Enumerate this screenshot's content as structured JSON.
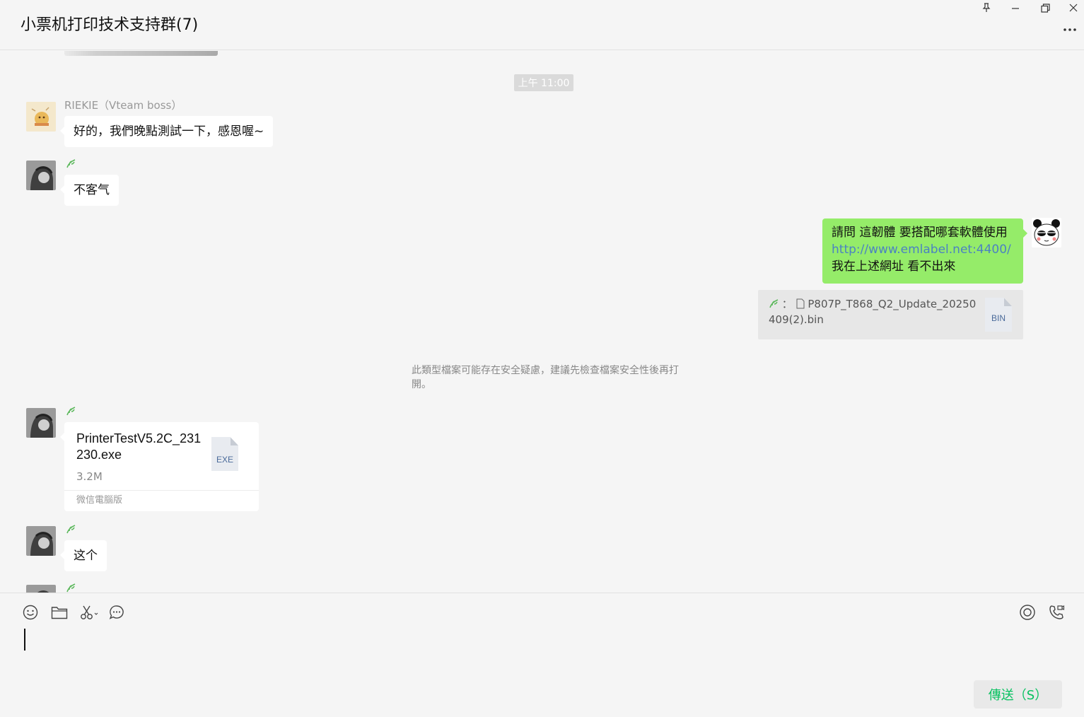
{
  "window": {
    "title": "小票机打印技术支持群(7)",
    "controls": [
      "pin-icon",
      "minimize-icon",
      "restore-icon",
      "close-icon"
    ],
    "more_label": "···"
  },
  "chat": {
    "timestamp": "上午 11:00",
    "messages": [
      {
        "sender": "RIEKIE（Vteam boss）",
        "text": "好的，我們晚點測試一下，感恩喔~"
      },
      {
        "sender_icon": "leaf-icon",
        "text": "不客气"
      },
      {
        "self": true,
        "lines": [
          "請問 這韌體 要搭配哪套軟體使用",
          "http://www.emlabel.net:4400/",
          "我在上述網址 看不出來"
        ],
        "quote": {
          "prefix": "：",
          "file_name_line1": "P807P_T868_Q2_Update_20250",
          "file_name_line2": "409(2).bin",
          "ext": "BIN"
        }
      },
      {
        "system": true,
        "text": "此類型檔案可能存在安全疑慮，建議先檢查檔案安全性後再打開。"
      },
      {
        "sender_icon": "leaf-icon",
        "file": {
          "name": "PrinterTestV5.2C_231230.exe",
          "size": "3.2M",
          "source": "微信電腦版",
          "ext": "EXE"
        }
      },
      {
        "sender_icon": "leaf-icon",
        "text": "这个"
      }
    ]
  },
  "input": {
    "tools": [
      "emoji-icon",
      "folder-icon",
      "scissors-icon",
      "chat-history-icon"
    ],
    "right_tools": [
      "live-icon",
      "call-icon"
    ],
    "send_label": "傳送（S）"
  },
  "colors": {
    "self_bubble": "#95ec69",
    "link": "#4b82c3",
    "send_text": "#07c160"
  }
}
